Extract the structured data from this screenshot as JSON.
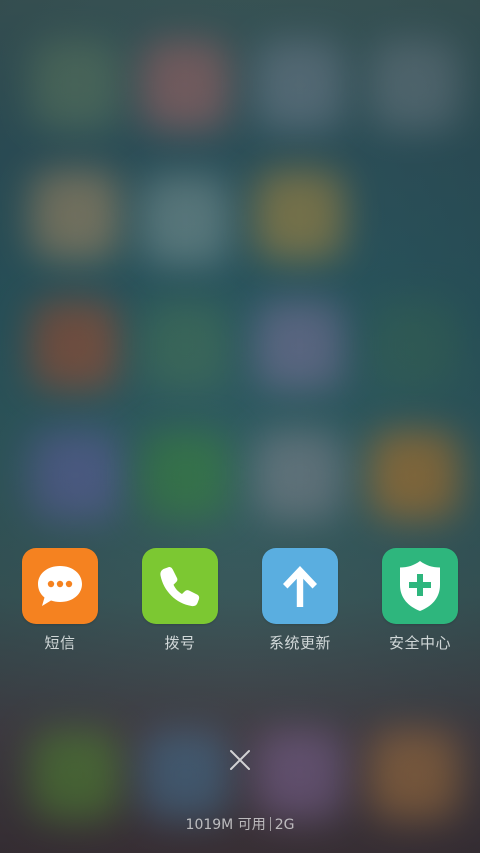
{
  "recent_apps": [
    {
      "label": "短信",
      "icon": "message-bubble-icon",
      "color": "#F58220"
    },
    {
      "label": "拨号",
      "icon": "phone-handset-icon",
      "color": "#7CC832"
    },
    {
      "label": "系统更新",
      "icon": "arrow-up-icon",
      "color": "#5AAEE0"
    },
    {
      "label": "安全中心",
      "icon": "shield-plus-icon",
      "color": "#2EB67D"
    }
  ],
  "close": {
    "icon": "close-icon"
  },
  "memory": {
    "available": "1019M 可用",
    "total": "2G"
  }
}
